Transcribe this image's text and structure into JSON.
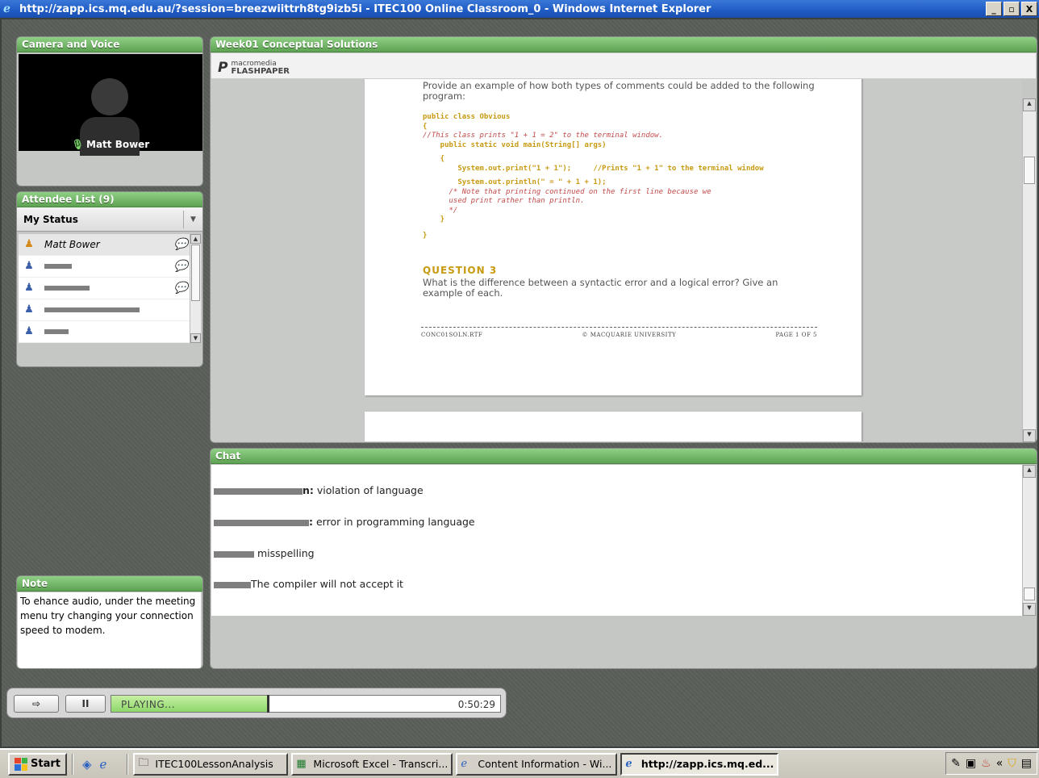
{
  "window": {
    "title": "http://zapp.ics.mq.edu.au/?session=breezwiittrh8tg9izb5i - ITEC100 Online Classroom_0 - Windows Internet Explorer",
    "min": "_",
    "max": "̅□",
    "close": "X"
  },
  "camera": {
    "title": "Camera and Voice",
    "name": "Matt Bower"
  },
  "attendees": {
    "title": "Attendee List (9)",
    "my_status": "My Status",
    "items": [
      {
        "name": "Matt Bower"
      }
    ]
  },
  "note": {
    "title": "Note",
    "text": "To ehance audio, under the meeting menu try changing your connection speed to modem."
  },
  "flashpaper": {
    "title": "Week01 Conceptual Solutions",
    "logo_top": "macromedia",
    "logo_bottom": "FLASHPAPER",
    "intro": "Provide an example of how both types of comments could be added to the following program:",
    "code": {
      "l1": "public class Obvious",
      "l2": "{",
      "l3": "//This class prints \"1 + 1 = 2\" to the terminal window.",
      "l4": "    public static void main(String[] args)",
      "l5": "    {",
      "l6a": "        System.out.print(\"1 + 1\");",
      "l6b": "//Prints \"1 + 1\" to the terminal window",
      "l7": "        System.out.println(\" = \" + 1 + 1);",
      "l8": "      /* Note that printing continued on the first line because we",
      "l9": "      used print rather than println.",
      "l10": "      */",
      "l11": "    }",
      "l12": "}"
    },
    "q3_head": "QUESTION 3",
    "q3_text": "What is the difference between a syntactic error and a logical error? Give an example of each.",
    "footer_left": "CONC01SOLN.RTF",
    "footer_mid": "© MACQUARIE UNIVERSITY",
    "footer_right": "PAGE 1 OF 5"
  },
  "chat": {
    "title": "Chat",
    "messages": [
      {
        "sender_suffix": "n:",
        "text": " violation of language"
      },
      {
        "sender_suffix": ":",
        "text": " error in programming language"
      },
      {
        "sender_suffix": "",
        "text": " misspelling"
      },
      {
        "sender_suffix": "",
        "text": "The compiler will not accept it"
      }
    ]
  },
  "player": {
    "status": "PLAYING...",
    "time": "0:50:29",
    "progress_fraction": 0.4,
    "pause_label": "II"
  },
  "taskbar": {
    "start": "Start",
    "tasks": [
      {
        "icon": "folder-icon",
        "label": "ITEC100LessonAnalysis"
      },
      {
        "icon": "excel-icon",
        "label": "Microsoft Excel - Transcri..."
      },
      {
        "icon": "ie-icon",
        "label": "Content Information - Wi..."
      },
      {
        "icon": "ie-icon",
        "label": "http://zapp.ics.mq.ed..."
      }
    ]
  },
  "colors": {
    "panel_header": "#6fb364",
    "doc_accent": "#c89a10",
    "comment": "#c24a4a"
  }
}
